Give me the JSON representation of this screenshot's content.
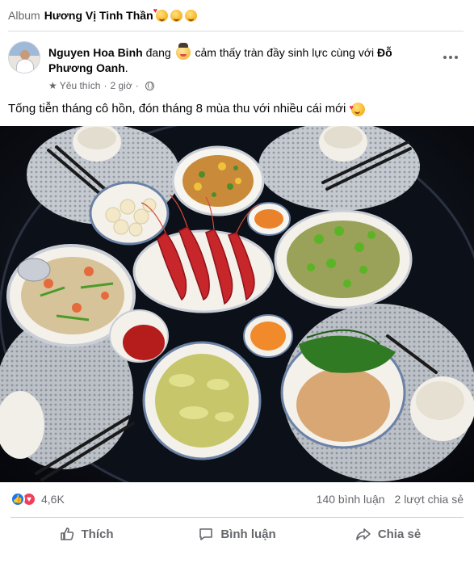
{
  "album": {
    "label": "Album",
    "name": "Hương Vị Tinh Thần"
  },
  "post": {
    "author": "Nguyen Hoa Binh",
    "feeling_prefix": "đang",
    "feeling_text": "cảm thấy tràn đầy sinh lực cùng với",
    "tagged": "Đỗ Phương Oanh",
    "tagged_suffix": ".",
    "favorite_label": "Yêu thích",
    "time": "2 giờ",
    "caption": "Tống tiễn tháng cô hồn, đón tháng 8 mùa thu với nhiều cái mới",
    "photo_icon": "food-table-photo"
  },
  "stats": {
    "reactions_count": "4,6K",
    "comments": "140 bình luận",
    "shares": "2 lượt chia sẻ"
  },
  "actions": {
    "like": "Thích",
    "comment": "Bình luận",
    "share": "Chia sẻ"
  },
  "colors": {
    "accent": "#1877f2",
    "love": "#f33e58",
    "secondary_text": "#65676b"
  },
  "icons": [
    "globe-icon",
    "star-icon",
    "more-icon",
    "like-icon",
    "comment-icon",
    "share-icon"
  ]
}
